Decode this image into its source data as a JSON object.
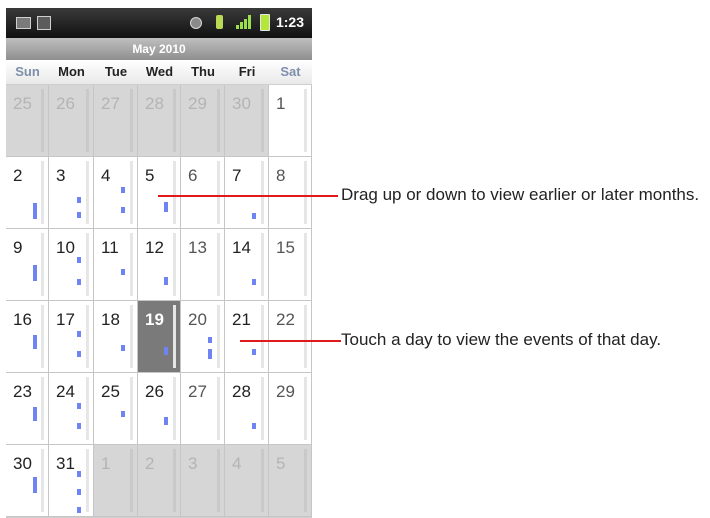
{
  "status_bar": {
    "time": "1:23",
    "icons": [
      "mail-icon",
      "calendar-icon",
      "gps-icon",
      "usb-icon",
      "signal-icon",
      "battery-icon"
    ]
  },
  "calendar": {
    "month_title": "May 2010",
    "weekdays": [
      "Sun",
      "Mon",
      "Tue",
      "Wed",
      "Thu",
      "Fri",
      "Sat"
    ],
    "weeks": [
      [
        "25",
        "26",
        "27",
        "28",
        "29",
        "30",
        "1"
      ],
      [
        "2",
        "3",
        "4",
        "5",
        "6",
        "7",
        "8"
      ],
      [
        "9",
        "10",
        "11",
        "12",
        "13",
        "14",
        "15"
      ],
      [
        "16",
        "17",
        "18",
        "19",
        "20",
        "21",
        "22"
      ],
      [
        "23",
        "24",
        "25",
        "26",
        "27",
        "28",
        "29"
      ],
      [
        "30",
        "31",
        "1",
        "2",
        "3",
        "4",
        "5"
      ]
    ],
    "selected_day": "19",
    "colors": {
      "event": "#6f83f3",
      "selected": "#7a7a7a",
      "other_month": "#d6d6d6"
    }
  },
  "callouts": [
    {
      "text": "Drag up or down to view earlier or later months."
    },
    {
      "text": "Touch a day to view the events of that day."
    }
  ]
}
